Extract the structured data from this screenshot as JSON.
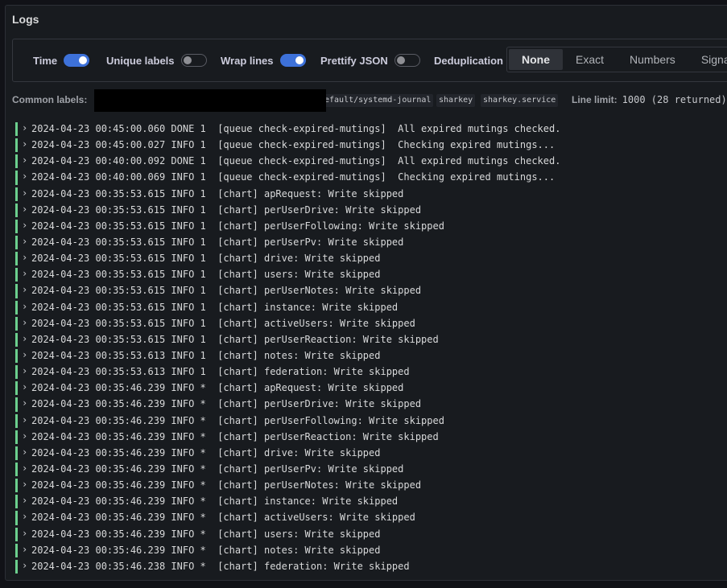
{
  "panel": {
    "title": "Logs"
  },
  "options": {
    "time": {
      "label": "Time",
      "on": true
    },
    "unique_labels": {
      "label": "Unique labels",
      "on": false
    },
    "wrap_lines": {
      "label": "Wrap lines",
      "on": true
    },
    "prettify_json": {
      "label": "Prettify JSON",
      "on": false
    },
    "deduplication": {
      "label": "Deduplication",
      "selected": "None",
      "options": [
        "None",
        "Exact",
        "Numbers",
        "Signature"
      ]
    }
  },
  "common_labels": {
    "label": "Common labels:",
    "chips": [
      "efault/systemd-journal",
      "sharkey",
      "sharkey.service"
    ],
    "line_limit_label": "Line limit:",
    "line_limit_value": "1000 (28 returned)"
  },
  "colors": {
    "accent": "#3d71d9",
    "log_level_bar": "#6ccf8e"
  },
  "logs": [
    "2024-04-23 00:45:00.060 DONE 1  [queue check-expired-mutings]  All expired mutings checked.",
    "2024-04-23 00:45:00.027 INFO 1  [queue check-expired-mutings]  Checking expired mutings...",
    "2024-04-23 00:40:00.092 DONE 1  [queue check-expired-mutings]  All expired mutings checked.",
    "2024-04-23 00:40:00.069 INFO 1  [queue check-expired-mutings]  Checking expired mutings...",
    "2024-04-23 00:35:53.615 INFO 1  [chart] apRequest: Write skipped",
    "2024-04-23 00:35:53.615 INFO 1  [chart] perUserDrive: Write skipped",
    "2024-04-23 00:35:53.615 INFO 1  [chart] perUserFollowing: Write skipped",
    "2024-04-23 00:35:53.615 INFO 1  [chart] perUserPv: Write skipped",
    "2024-04-23 00:35:53.615 INFO 1  [chart] drive: Write skipped",
    "2024-04-23 00:35:53.615 INFO 1  [chart] users: Write skipped",
    "2024-04-23 00:35:53.615 INFO 1  [chart] perUserNotes: Write skipped",
    "2024-04-23 00:35:53.615 INFO 1  [chart] instance: Write skipped",
    "2024-04-23 00:35:53.615 INFO 1  [chart] activeUsers: Write skipped",
    "2024-04-23 00:35:53.615 INFO 1  [chart] perUserReaction: Write skipped",
    "2024-04-23 00:35:53.613 INFO 1  [chart] notes: Write skipped",
    "2024-04-23 00:35:53.613 INFO 1  [chart] federation: Write skipped",
    "2024-04-23 00:35:46.239 INFO *  [chart] apRequest: Write skipped",
    "2024-04-23 00:35:46.239 INFO *  [chart] perUserDrive: Write skipped",
    "2024-04-23 00:35:46.239 INFO *  [chart] perUserFollowing: Write skipped",
    "2024-04-23 00:35:46.239 INFO *  [chart] perUserReaction: Write skipped",
    "2024-04-23 00:35:46.239 INFO *  [chart] drive: Write skipped",
    "2024-04-23 00:35:46.239 INFO *  [chart] perUserPv: Write skipped",
    "2024-04-23 00:35:46.239 INFO *  [chart] perUserNotes: Write skipped",
    "2024-04-23 00:35:46.239 INFO *  [chart] instance: Write skipped",
    "2024-04-23 00:35:46.239 INFO *  [chart] activeUsers: Write skipped",
    "2024-04-23 00:35:46.239 INFO *  [chart] users: Write skipped",
    "2024-04-23 00:35:46.239 INFO *  [chart] notes: Write skipped",
    "2024-04-23 00:35:46.238 INFO *  [chart] federation: Write skipped"
  ]
}
